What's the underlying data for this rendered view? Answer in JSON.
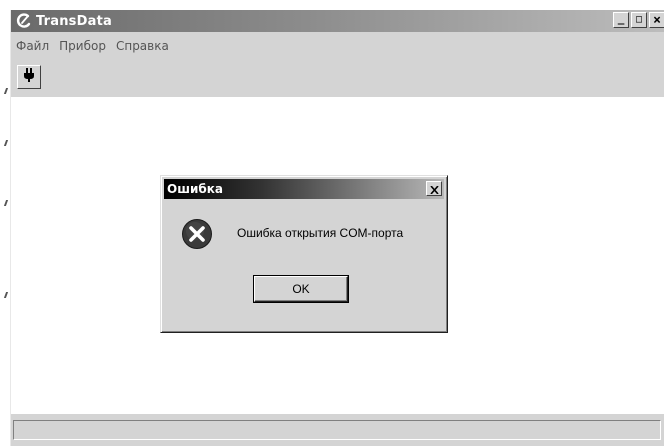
{
  "window": {
    "title": "TransData",
    "minimize_glyph": "_",
    "maximize_glyph": "□",
    "close_glyph": "×"
  },
  "menu": {
    "items": [
      {
        "label": "Файл"
      },
      {
        "label": "Прибор"
      },
      {
        "label": "Справка"
      }
    ]
  },
  "toolbar": {
    "connect_icon": "plug-icon"
  },
  "status": {
    "text": ""
  },
  "dialog": {
    "title": "Ошибка",
    "message": "Ошибка открытия COM-порта",
    "ok_label": "OK",
    "icon": "error-icon"
  },
  "colors": {
    "titlebar_start": "#6a6a6a",
    "titlebar_end": "#bdbdbd",
    "window_bg": "#d4d4d4",
    "content_bg": "#ffffff",
    "dialog_title_start": "#000000",
    "dialog_title_end": "#b8b8b8",
    "error_icon_bg": "#3a3a3a"
  }
}
